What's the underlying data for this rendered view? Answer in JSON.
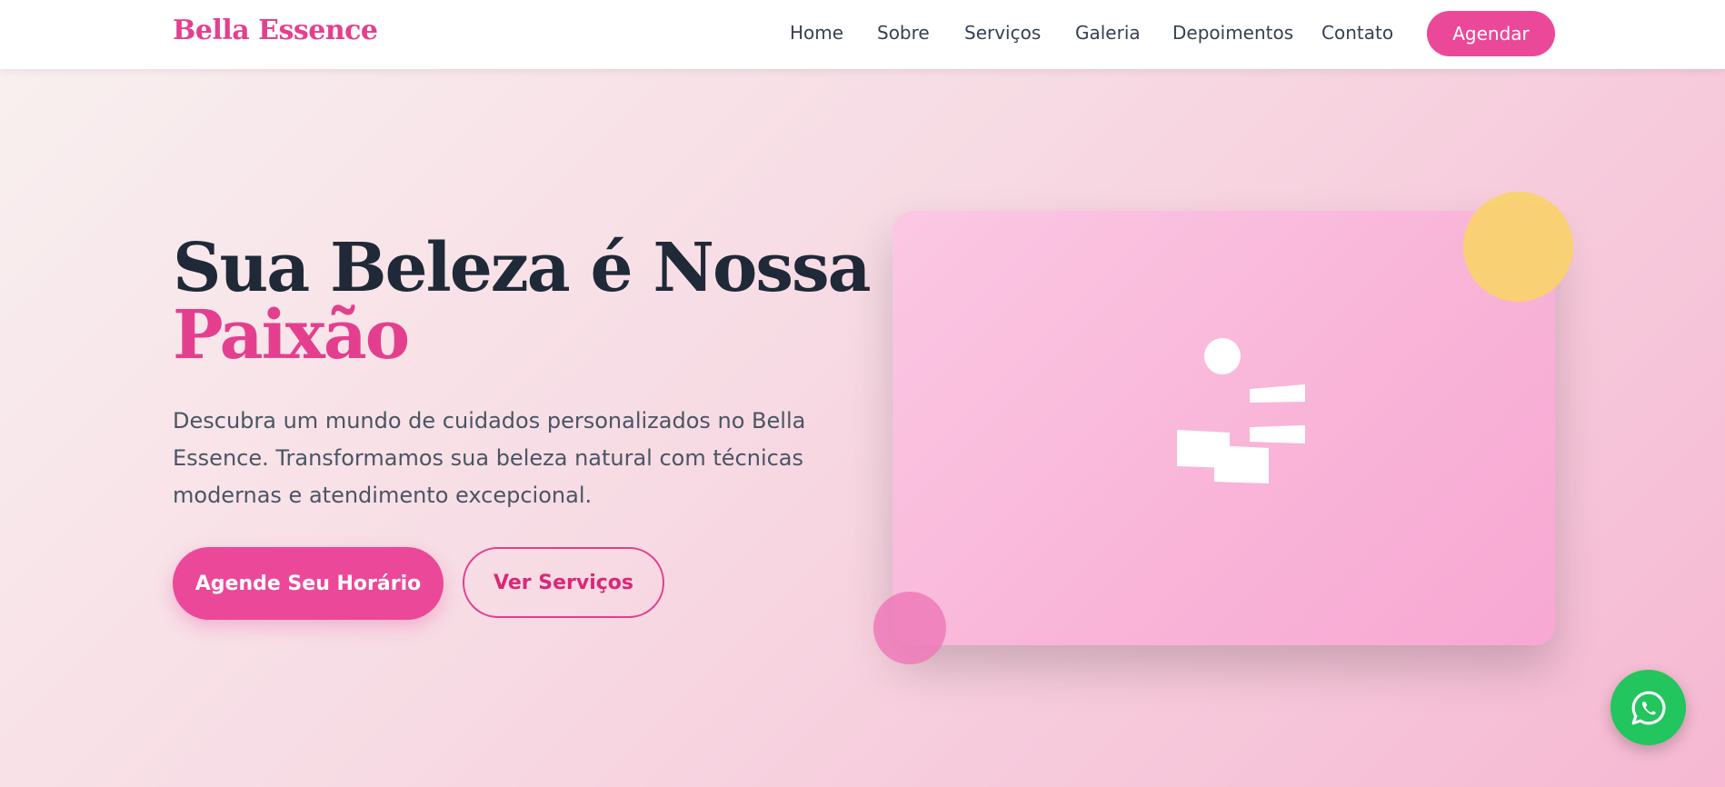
{
  "header": {
    "brand": "Bella Essence",
    "nav": [
      {
        "label": "Home"
      },
      {
        "label": "Sobre"
      },
      {
        "label": "Serviços"
      },
      {
        "label": "Galeria"
      },
      {
        "label": "Depoimentos"
      },
      {
        "label": "Contato"
      }
    ],
    "cta_label": "Agendar"
  },
  "hero": {
    "title_line1": "Sua Beleza é Nossa",
    "title_accent": "Paixão",
    "description": "Descubra um mundo de cuidados personalizados no Bella Essence. Transformamos sua beleza natural com técnicas modernas e atendimento excepcional.",
    "primary_button": "Agende Seu Horário",
    "secondary_button": "Ver Serviços",
    "illustration_icon": "person-pose-icon"
  },
  "floating": {
    "whatsapp_icon": "whatsapp-icon"
  },
  "colors": {
    "brand_pink": "#ec4899",
    "accent_text": "#e43f8f",
    "heading_dark": "#1f2937",
    "whatsapp_green": "#22c55e",
    "decor_yellow": "#f9d26f"
  }
}
